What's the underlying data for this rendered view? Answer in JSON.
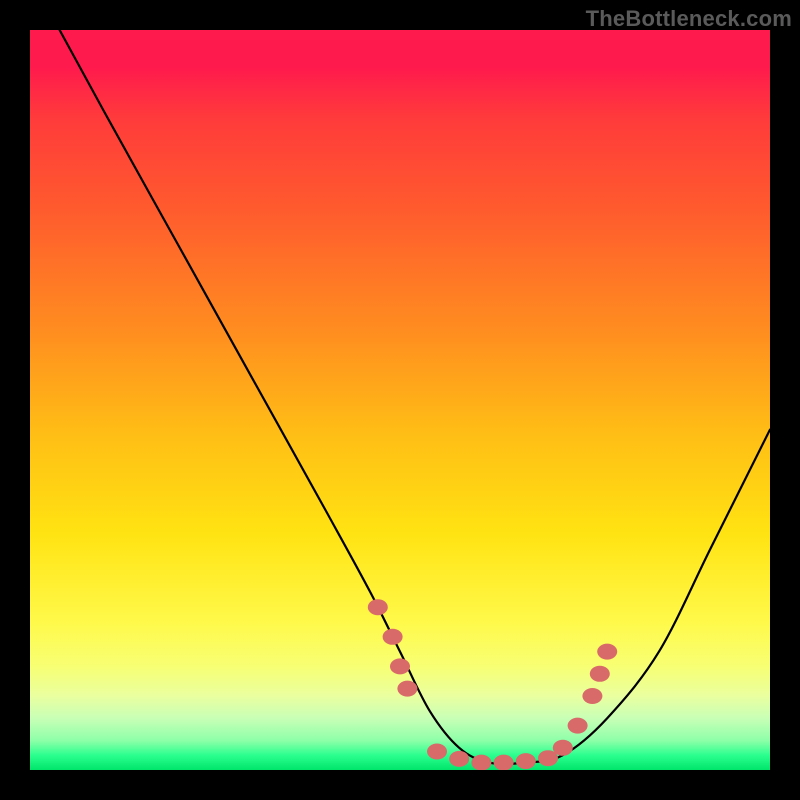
{
  "watermark": "TheBottleneck.com",
  "chart_data": {
    "type": "line",
    "title": "",
    "xlabel": "",
    "ylabel": "",
    "xlim": [
      0,
      100
    ],
    "ylim": [
      0,
      100
    ],
    "series": [
      {
        "name": "bottleneck-curve",
        "x": [
          4,
          10,
          20,
          30,
          40,
          46,
          50,
          54,
          58,
          62,
          67,
          72,
          78,
          85,
          92,
          100
        ],
        "values": [
          100,
          89,
          71,
          53,
          35,
          24,
          16,
          8,
          3,
          1,
          1,
          2,
          7,
          16,
          30,
          46
        ]
      }
    ],
    "markers": {
      "name": "highlight-points",
      "color": "#d96a6a",
      "points": [
        {
          "x": 47,
          "y": 22
        },
        {
          "x": 49,
          "y": 18
        },
        {
          "x": 50,
          "y": 14
        },
        {
          "x": 51,
          "y": 11
        },
        {
          "x": 55,
          "y": 2.5
        },
        {
          "x": 58,
          "y": 1.5
        },
        {
          "x": 61,
          "y": 1.0
        },
        {
          "x": 64,
          "y": 1.0
        },
        {
          "x": 67,
          "y": 1.2
        },
        {
          "x": 70,
          "y": 1.6
        },
        {
          "x": 72,
          "y": 3.0
        },
        {
          "x": 74,
          "y": 6.0
        },
        {
          "x": 76,
          "y": 10.0
        },
        {
          "x": 77,
          "y": 13.0
        },
        {
          "x": 78,
          "y": 16.0
        }
      ]
    }
  }
}
